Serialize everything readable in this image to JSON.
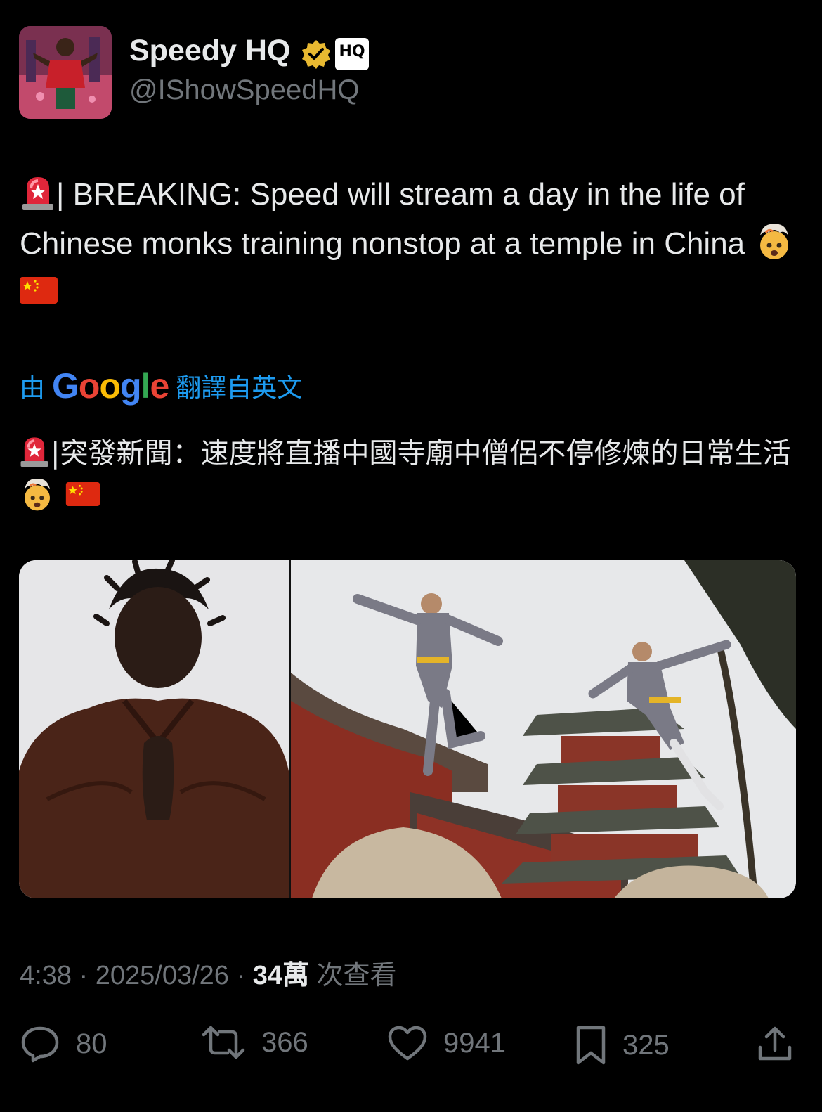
{
  "author": {
    "display_name": "Speedy HQ",
    "handle": "@IShowSpeedHQ",
    "badge_text": "HQ",
    "verified_color": "#e8b931"
  },
  "tweet": {
    "text_part1": "| BREAKING: Speed will stream a day in the life of Chinese monks training nonstop at a temple in China",
    "translation_prefix": "由",
    "translation_brand": "Google",
    "translation_suffix": "翻譯自英文",
    "translated_part1": "|突發新聞：速度將直播中國寺廟中僧侶不停修煉的日常生活",
    "emojis": [
      "siren-icon",
      "exploding-head-icon",
      "china-flag-icon"
    ]
  },
  "meta": {
    "time": "4:38",
    "sep1": " · ",
    "date": "2025/03/26",
    "sep2": " · ",
    "views": "34萬",
    "views_label": " 次查看"
  },
  "actions": {
    "replies": "80",
    "reposts": "366",
    "likes": "9941",
    "bookmarks": "325"
  },
  "colors": {
    "background": "#000000",
    "text": "#e7e9ea",
    "secondary": "#71767b",
    "link": "#1d9bf0"
  }
}
